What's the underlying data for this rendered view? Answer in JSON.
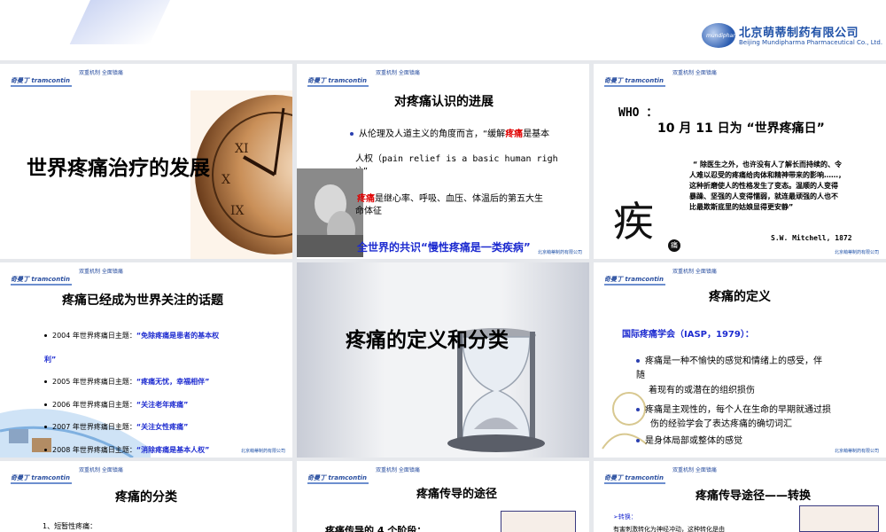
{
  "company": {
    "name_cn": "北京萌蒂制药有限公司",
    "name_en": "Beijing Mundipharma Pharmaceutical Co., Ltd.",
    "mark": "mundipharma"
  },
  "slide_header": {
    "brand": "奇曼丁 tramcontin",
    "slogan": "双重机制  全面镇痛"
  },
  "footer_label": "北京萌蒂制药有限公司",
  "colors": {
    "accent_blue": "#1d2bd0",
    "highlight_red": "#e00000",
    "brand_blue": "#2052a8"
  },
  "slides": [
    {
      "title": "世界疼痛治疗的发展"
    },
    {
      "title": "对疼痛认识的进展",
      "line1": "从伦理及人道主义的角度而言，“缓解",
      "line1_highlight": "疼痛",
      "line1_end": "是基本",
      "line2": "人权（pain relief is a basic human righ",
      "line3": "t）”",
      "line4_highlight": "疼痛",
      "line4": "是继心率、呼吸、血压、体温后的第五大生",
      "line5": "命体征",
      "consensus": "全世界的共识“慢性疼痛是一类疾病”"
    },
    {
      "who": "WHO ：",
      "date_line": "10 月 11 日为 “世界疼痛日”",
      "quote": [
        "“ 除医生之外，也许没有人了解长而持续的、令",
        "人难以忍受的疼痛给肉体和精神带来的影响……，",
        "这种折磨使人的性格发生了变态。温顺的人变得",
        "暴躁、坚强的人变得懦弱，就连最顽强的人也不",
        "比最欺斯底里的姑娘显得更安静”"
      ],
      "glyph": "疾",
      "glyph2": "痛",
      "author": "S.W. Mitchell, 1872"
    },
    {
      "title": "疼痛已经成为世界关注的话题",
      "items": [
        {
          "prefix": "2004 年世界疼痛日主题：",
          "theme": "“免除疼痛是患者的基本权",
          "theme_cont": "利”"
        },
        {
          "prefix": "2005 年世界疼痛日主题：",
          "theme": "“疼痛无忧，幸福相伴”"
        },
        {
          "prefix": "2006 年世界疼痛日主题：",
          "theme": "“关注老年疼痛”"
        },
        {
          "prefix": "2007 年世界疼痛日主题：",
          "theme": "“关注女性疼痛”"
        },
        {
          "prefix": "2008 年世界疼痛日主题：",
          "theme": "“消除疼痛是基本人权”"
        }
      ]
    },
    {
      "title": "疼痛的定义和分类"
    },
    {
      "title": "疼痛的定义",
      "org": "国际疼痛学会（IASP，1979）：",
      "b1": "疼痛是一种不愉快的感觉和情绪上的感受，伴",
      "b1_a": "随",
      "b1_b": "着现有的或潜在的组织损伤",
      "b2": "疼痛是主观性的，每个人在生命的早期就通过损",
      "b2_b": "伤的经验学会了表达疼痛的确切词汇",
      "b3": "是身体局部或整体的感觉"
    },
    {
      "title": "疼痛的分类",
      "item1": "1、短暂性疼痛："
    },
    {
      "title": "疼痛传导的途径",
      "stage": "疼痛传导的 4 个阶段："
    },
    {
      "title": "疼痛传导途径——转换",
      "sub": "➢转换：",
      "text": "有害刺激转化为神经冲动，这种转化是由"
    }
  ]
}
